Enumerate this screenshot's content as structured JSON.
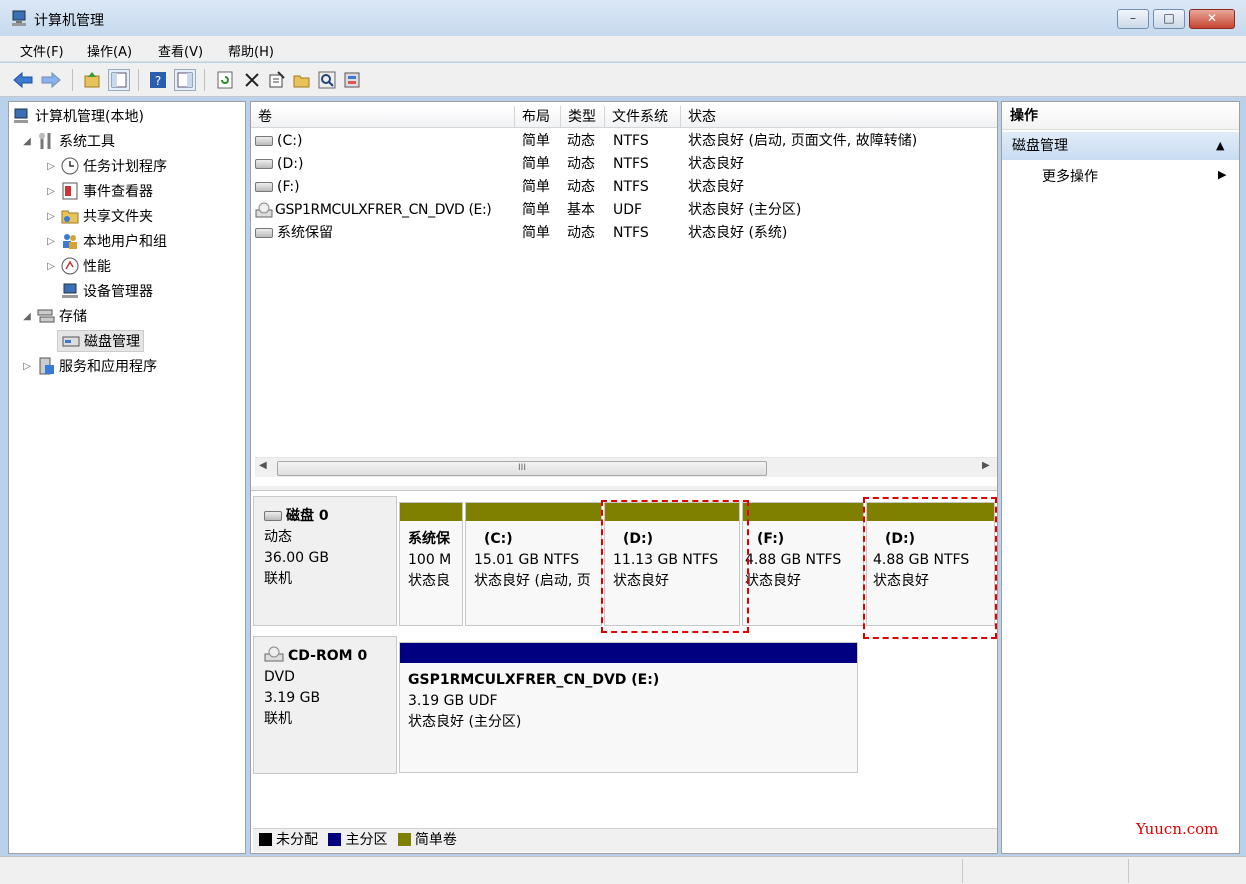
{
  "window": {
    "title": "计算机管理",
    "min": "–",
    "max": "□",
    "close": "✕"
  },
  "menu": [
    "文件(F)",
    "操作(A)",
    "查看(V)",
    "帮助(H)"
  ],
  "tree": [
    {
      "label": "计算机管理(本地)",
      "icon": "computer-management-icon"
    },
    {
      "label": "系统工具",
      "icon": "system-tools-icon"
    },
    {
      "label": "任务计划程序",
      "icon": "clock-icon"
    },
    {
      "label": "事件查看器",
      "icon": "event-viewer-icon"
    },
    {
      "label": "共享文件夹",
      "icon": "shared-folder-icon"
    },
    {
      "label": "本地用户和组",
      "icon": "users-icon"
    },
    {
      "label": "性能",
      "icon": "performance-icon"
    },
    {
      "label": "设备管理器",
      "icon": "device-manager-icon"
    },
    {
      "label": "存储",
      "icon": "storage-icon"
    },
    {
      "label": "磁盘管理",
      "icon": "disk-management-icon"
    },
    {
      "label": "服务和应用程序",
      "icon": "services-icon"
    }
  ],
  "volume_table": {
    "headers": [
      "卷",
      "布局",
      "类型",
      "文件系统",
      "状态"
    ],
    "rows": [
      [
        "(C:)",
        "简单",
        "动态",
        "NTFS",
        "状态良好 (启动, 页面文件, 故障转储)"
      ],
      [
        "(D:)",
        "简单",
        "动态",
        "NTFS",
        "状态良好"
      ],
      [
        "(F:)",
        "简单",
        "动态",
        "NTFS",
        "状态良好"
      ],
      [
        "GSP1RMCULXFRER_CN_DVD (E:)",
        "简单",
        "基本",
        "UDF",
        "状态良好 (主分区)"
      ],
      [
        "系统保留",
        "简单",
        "动态",
        "NTFS",
        "状态良好 (系统)"
      ]
    ],
    "scroll_thumb": "III"
  },
  "disks": [
    {
      "name": "磁盘 0",
      "type": "动态",
      "size": "36.00 GB",
      "status": "联机",
      "partitions": [
        {
          "name": "系统保",
          "size": "100 M",
          "status": "状态良"
        },
        {
          "name": "(C:)",
          "size": "15.01 GB NTFS",
          "status": "状态良好 (启动, 页"
        },
        {
          "name": "(D:)",
          "size": "11.13 GB NTFS",
          "status": "状态良好"
        },
        {
          "name": "(F:)",
          "size": "4.88 GB NTFS",
          "status": "状态良好"
        },
        {
          "name": "(D:)",
          "size": "4.88 GB NTFS",
          "status": "状态良好"
        }
      ]
    },
    {
      "name": "CD-ROM 0",
      "type": "DVD",
      "size": "3.19 GB",
      "status": "联机",
      "partitions": [
        {
          "name": "GSP1RMCULXFRER_CN_DVD  (E:)",
          "size": "3.19 GB UDF",
          "status": "状态良好 (主分区)"
        }
      ]
    }
  ],
  "legend": [
    "未分配",
    "主分区",
    "简单卷"
  ],
  "colors": {
    "unallocated": "#000000",
    "primary": "#000080",
    "simple": "#808000",
    "highlight": "#e00000"
  },
  "actions": {
    "header": "操作",
    "section": "磁盘管理",
    "more": "更多操作"
  },
  "watermark": "Yuucn.com"
}
